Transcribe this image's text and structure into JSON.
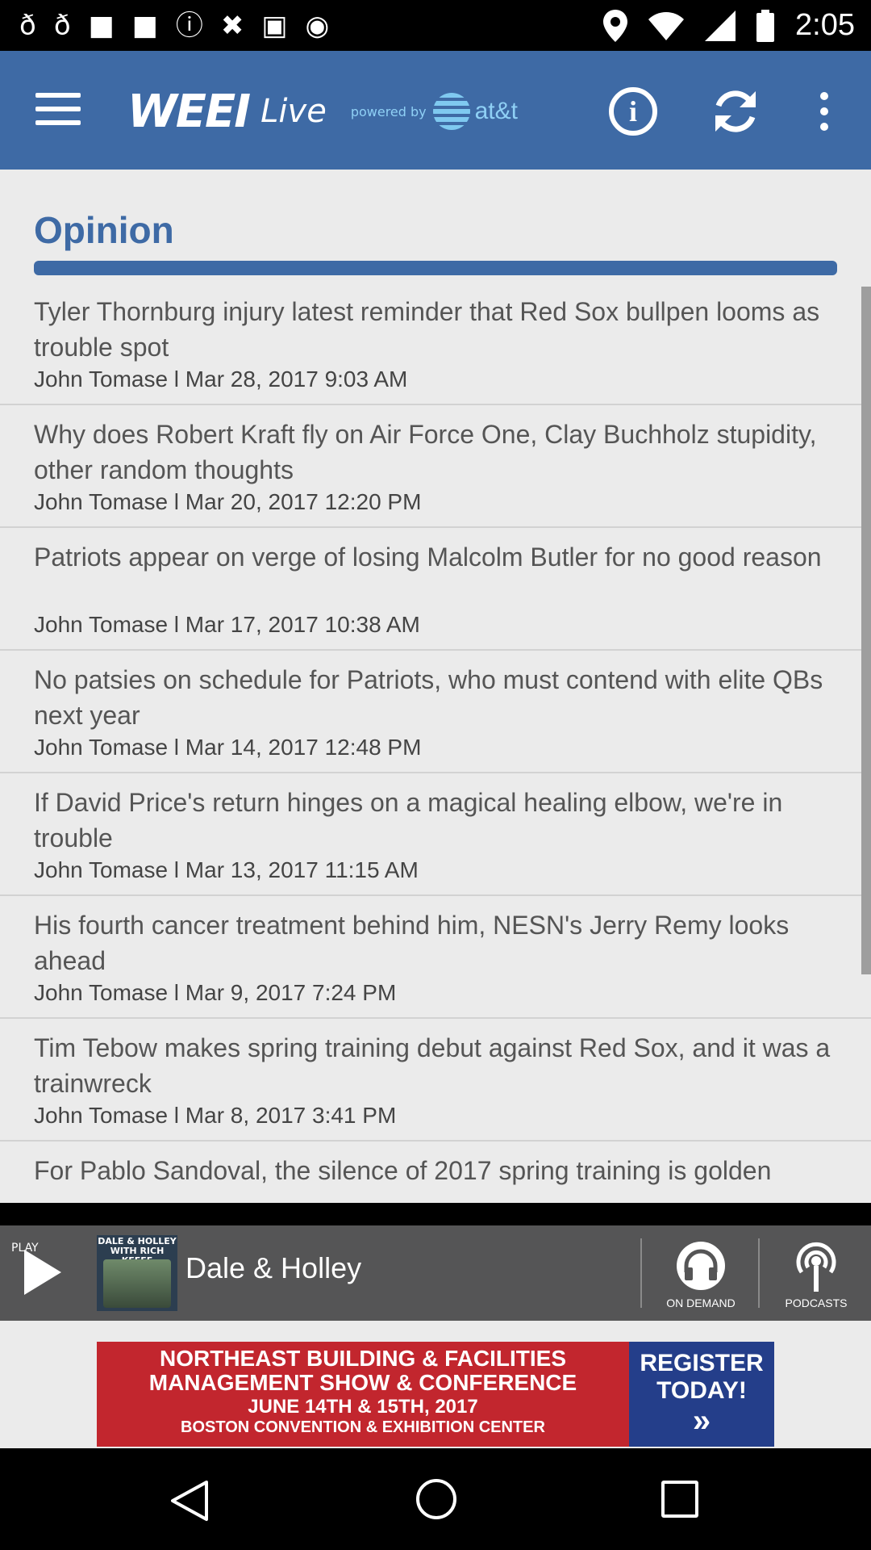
{
  "status_bar": {
    "time": "2:05",
    "left_icons": [
      "facebook-icon",
      "facebook-icon",
      "blank-square-icon",
      "blank-square-icon",
      "info-circle-icon",
      "fake-gps-icon",
      "lock-icon",
      "android-icon"
    ],
    "right_icons": [
      "location-pin-icon",
      "wifi-icon",
      "signal-icon",
      "battery-icon"
    ]
  },
  "app_bar": {
    "brand_weei": "WEEI",
    "brand_live": "Live",
    "powered_by": "powered by",
    "att": "at&t",
    "accent_color": "#3e6aa5"
  },
  "section": {
    "title": "Opinion"
  },
  "articles": [
    {
      "title": "Tyler Thornburg injury latest reminder that Red Sox bullpen looms as trouble spot",
      "meta": "John Tomase l Mar 28, 2017 9:03 AM"
    },
    {
      "title": "Why does Robert Kraft fly on Air Force One, Clay Buchholz stupidity, other random thoughts",
      "meta": "John Tomase l Mar 20, 2017 12:20 PM"
    },
    {
      "title": "Patriots appear on verge of losing Malcolm Butler for no good reason",
      "meta": "John Tomase l Mar 17, 2017 10:38 AM"
    },
    {
      "title": "No patsies on schedule for Patriots, who must contend with elite QBs next year",
      "meta": "John Tomase l Mar 14, 2017 12:48 PM"
    },
    {
      "title": "If David Price's return hinges on a magical healing elbow, we're in trouble",
      "meta": "John Tomase l Mar 13, 2017 11:15 AM"
    },
    {
      "title": "His fourth cancer treatment behind him, NESN's Jerry Remy looks ahead",
      "meta": "John Tomase l Mar 9, 2017 7:24 PM"
    },
    {
      "title": "Tim Tebow makes spring training debut against Red Sox, and it was a trainwreck",
      "meta": "John Tomase l Mar 8, 2017 3:41 PM"
    },
    {
      "title": "For Pablo Sandoval, the silence of 2017 spring training is golden",
      "meta": ""
    }
  ],
  "player": {
    "play_label": "PLAY",
    "thumb_caption": "DALE & HOLLEY WITH RICH KEEFE",
    "show_name": "Dale & Holley",
    "on_demand": "ON DEMAND",
    "podcasts": "PODCASTS"
  },
  "ad": {
    "line1": "NORTHEAST BUILDING & FACILITIES",
    "line2": "MANAGEMENT SHOW & CONFERENCE",
    "line3": "JUNE 14TH & 15TH, 2017",
    "line4": "BOSTON CONVENTION & EXHIBITION CENTER",
    "register": "REGISTER TODAY!",
    "arrows": "»"
  }
}
